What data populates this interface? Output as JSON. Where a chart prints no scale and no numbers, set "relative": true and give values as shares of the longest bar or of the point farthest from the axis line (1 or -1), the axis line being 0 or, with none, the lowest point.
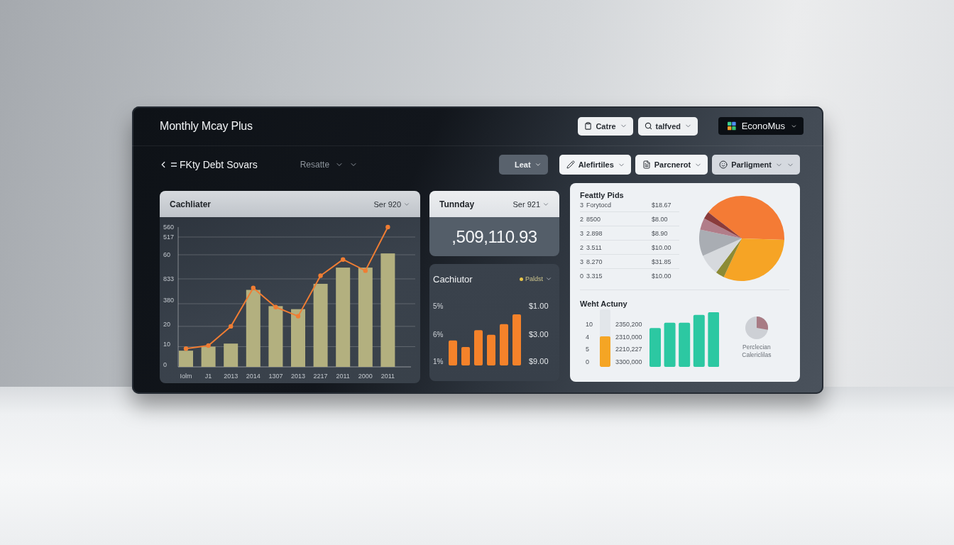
{
  "window": {
    "title": "Monthly Mcay Plus"
  },
  "header_dropdowns": [
    {
      "label": "Catre"
    },
    {
      "label": "talfved"
    }
  ],
  "workspace": {
    "label": "EconoMus"
  },
  "page": {
    "title": "FKty Debt Sovars",
    "view": "Resatte"
  },
  "period": {
    "label": "Leat"
  },
  "filters": [
    {
      "label": "Alefirtiles",
      "selected": false
    },
    {
      "label": "Parcnerot",
      "selected": false
    },
    {
      "label": "Parligment",
      "selected": true
    }
  ],
  "trend_card": {
    "title": "Cachliater",
    "range": "Ser 920",
    "y_axis_extra_labels": [
      "560",
      "517",
      "60",
      "833",
      "380"
    ],
    "chart_data": {
      "type": "bar",
      "categories": [
        "Iolm",
        "J1",
        "2013",
        "2014",
        "1307",
        "2013",
        "2217",
        "2011",
        "2000",
        "2011"
      ],
      "ylim": [
        0,
        69
      ],
      "yticks": [
        0,
        10,
        20
      ],
      "grid": true,
      "series": [
        {
          "color": "#b3b07f",
          "values": [
            8,
            10,
            11.5,
            38,
            30,
            28.5,
            41,
            49,
            49,
            56
          ]
        },
        {
          "type": "line",
          "marker": true,
          "color": "#f07d33",
          "values": [
            9,
            10.5,
            20,
            39,
            29.5,
            25,
            45,
            53,
            47.5,
            69
          ]
        }
      ]
    }
  },
  "total_card": {
    "title": "Tunnday",
    "range": "Ser 921",
    "value": ",509,110.93"
  },
  "mini_card": {
    "title": "Cachiutor",
    "legend": "Paldst",
    "axis_labels": [
      "5%",
      "6%",
      "1%"
    ],
    "amounts": [
      "$1.00",
      "$3.00",
      "$9.00"
    ],
    "chart_data": {
      "type": "bar",
      "categories": [
        null,
        null,
        null,
        null,
        null,
        null
      ],
      "relative": true,
      "series": [
        {
          "color": "#f5822a",
          "values": [
            0.49,
            0.36,
            0.69,
            0.6,
            0.81,
            1.0
          ]
        }
      ]
    }
  },
  "side_panel": {
    "table": {
      "title": "Feattly Pids",
      "rows": [
        {
          "column_1": "3",
          "column_2": "Forytocd",
          "column_3": "$18.67"
        },
        {
          "column_1": "2",
          "column_2": "8500",
          "column_3": "$8.00"
        },
        {
          "column_1": "3",
          "column_2": "2.898",
          "column_3": "$8.90"
        },
        {
          "column_1": "2",
          "column_2": "3.511",
          "column_3": "$10.00"
        },
        {
          "column_1": "3",
          "column_2": "8.270",
          "column_3": "$31.85"
        },
        {
          "column_1": "0",
          "column_2": "3.315",
          "column_3": "$10.00"
        }
      ]
    },
    "activity": {
      "title": "Weht Actuny",
      "axis_labels": [
        "10",
        "4",
        "5",
        "0"
      ],
      "meter": {
        "level": 0.53
      },
      "amounts": [
        "2350,200",
        "2310,000",
        "2210,227",
        "3300,000"
      ],
      "chart_data": {
        "type": "bar",
        "categories": [
          null,
          null,
          null,
          null,
          null
        ],
        "relative": true,
        "series": [
          {
            "color": "#2cc8a2",
            "values": [
              0.71,
              0.81,
              0.81,
              0.95,
              1.0
            ]
          }
        ]
      },
      "caption": "Perclecian Calericlilas"
    }
  }
}
